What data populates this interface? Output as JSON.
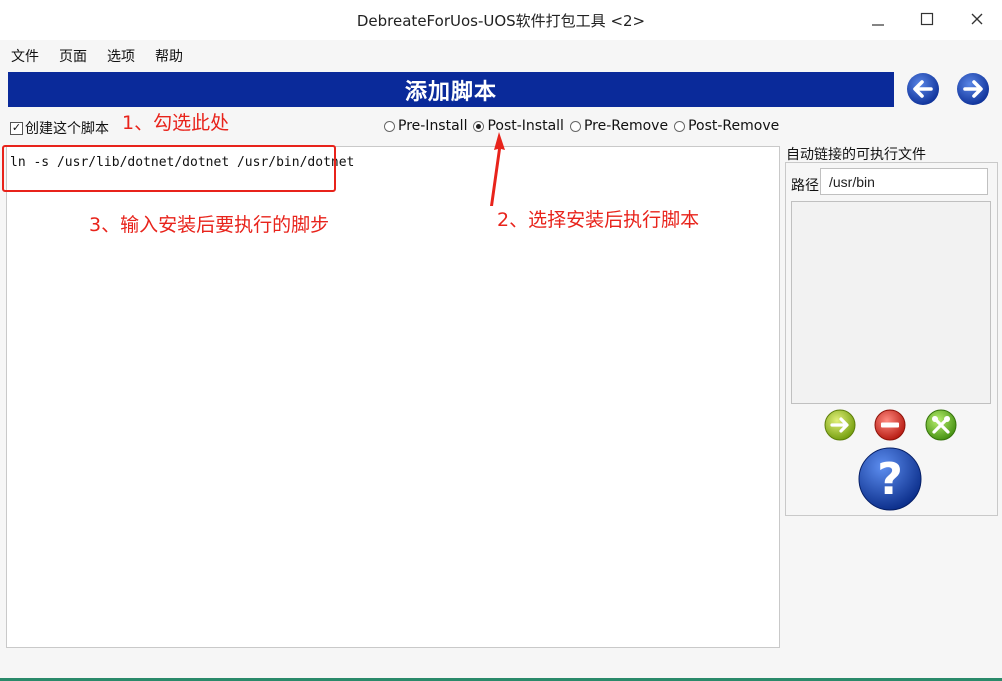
{
  "window": {
    "title": "DebreateForUos-UOS软件打包工具 <2>"
  },
  "menu": [
    "文件",
    "页面",
    "选项",
    "帮助"
  ],
  "header": {
    "title": "添加脚本",
    "accent": "#0a2a9a"
  },
  "script": {
    "create_label": "创建这个脚本",
    "create_checked": true,
    "types": [
      {
        "label": "Pre-Install",
        "selected": false
      },
      {
        "label": "Post-Install",
        "selected": true
      },
      {
        "label": "Pre-Remove",
        "selected": false
      },
      {
        "label": "Post-Remove",
        "selected": false
      }
    ],
    "content": "ln -s /usr/lib/dotnet/dotnet /usr/bin/dotnet"
  },
  "autolink": {
    "title": "自动链接的可执行文件",
    "path_label": "路径",
    "path_value": "/usr/bin",
    "buttons": [
      "add-icon",
      "remove-icon",
      "tools-icon"
    ],
    "help_icon": "help-icon"
  },
  "annotations": {
    "step1": "1、勾选此处",
    "step2": "2、选择安装后执行脚本",
    "step3": "3、输入安装后要执行的脚步",
    "color": "#e8231b"
  }
}
